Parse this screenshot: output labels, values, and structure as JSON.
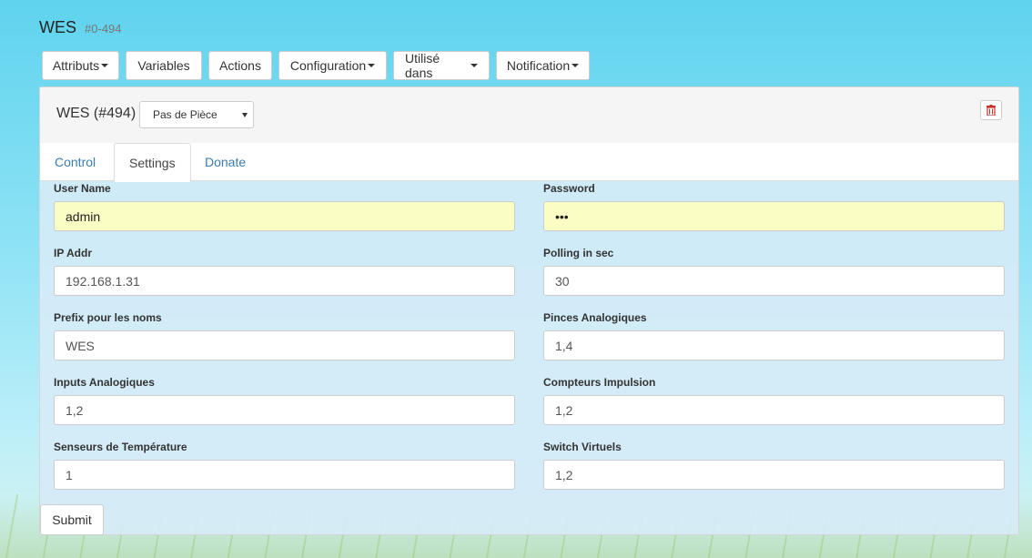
{
  "page": {
    "title": "WES",
    "title_id": "#0-494"
  },
  "toolbar": {
    "attributs": "Attributs",
    "variables": "Variables",
    "actions": "Actions",
    "configuration": "Configuration",
    "utilise_dans": "Utilisé dans",
    "notification": "Notification"
  },
  "panel": {
    "equipment_name": "WES (#494)",
    "room_select": "Pas de Pièce",
    "delete_icon": "trash-icon"
  },
  "tabs": [
    {
      "label": "Control",
      "active": false
    },
    {
      "label": "Settings",
      "active": true
    },
    {
      "label": "Donate",
      "active": false
    }
  ],
  "form": {
    "user_name": {
      "label": "User Name",
      "value": "admin"
    },
    "password": {
      "label": "Password",
      "value": "•••"
    },
    "ip_addr": {
      "label": "IP Addr",
      "value": "192.168.1.31"
    },
    "polling": {
      "label": "Polling in sec",
      "value": "30"
    },
    "prefix": {
      "label": "Prefix pour les noms",
      "value": "WES"
    },
    "pinces": {
      "label": "Pinces Analogiques",
      "value": "1,4"
    },
    "inputs": {
      "label": "Inputs Analogiques",
      "value": "1,2"
    },
    "compteurs": {
      "label": "Compteurs Impulsion",
      "value": "1,2"
    },
    "senseurs": {
      "label": "Senseurs de Température",
      "value": "1"
    },
    "switch": {
      "label": "Switch Virtuels",
      "value": "1,2"
    }
  },
  "submit": "Submit",
  "colors": {
    "link": "#3a7cb0",
    "autofill": "#fafdc4",
    "panel_body": "#d6ecf7"
  }
}
